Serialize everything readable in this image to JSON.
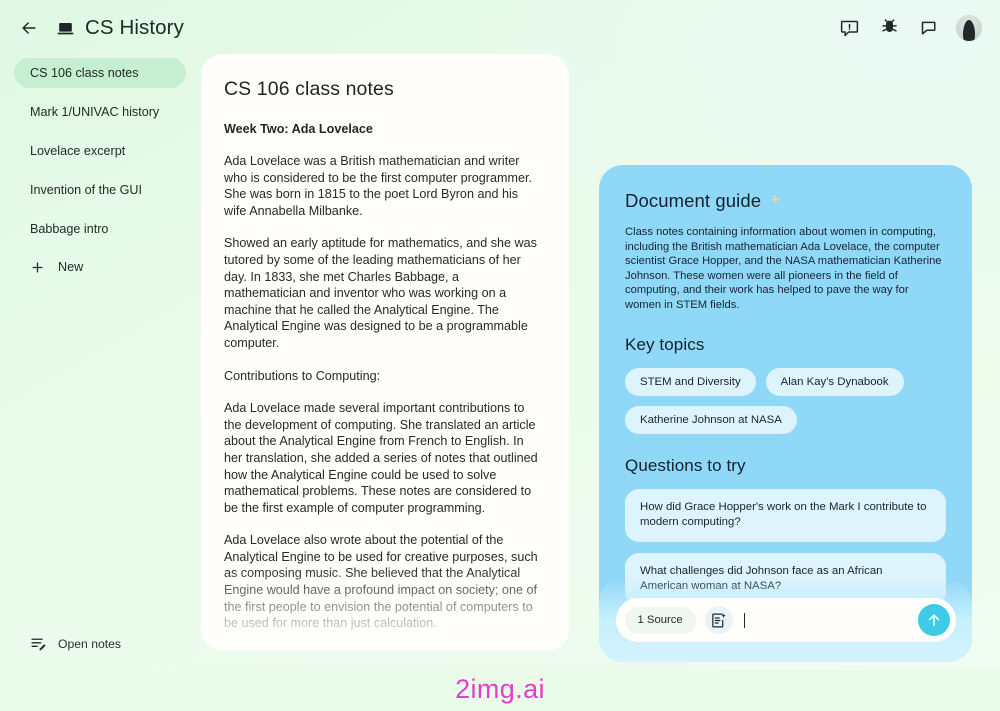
{
  "header": {
    "back_icon": "arrow-left-icon",
    "doc_icon": "laptop-icon",
    "title": "CS History",
    "actions": [
      {
        "name": "feedback-icon",
        "label": "Feedback"
      },
      {
        "name": "bug-report-icon",
        "label": "Report a bug"
      },
      {
        "name": "chat-icon",
        "label": "Chat"
      },
      {
        "name": "avatar",
        "label": "Account"
      }
    ]
  },
  "sidebar": {
    "items": [
      {
        "label": "CS 106 class notes",
        "active": true
      },
      {
        "label": "Mark 1/UNIVAC history",
        "active": false
      },
      {
        "label": "Lovelace excerpt",
        "active": false
      },
      {
        "label": "Invention of the GUI",
        "active": false
      },
      {
        "label": "Babbage intro",
        "active": false
      }
    ],
    "new_label": "New",
    "new_icon": "plus-icon",
    "open_notes_label": "Open notes",
    "open_notes_icon": "edit-note-icon"
  },
  "document": {
    "title": "CS 106 class notes",
    "subtitle": "Week Two: Ada Lovelace",
    "paragraphs": [
      "Ada Lovelace was a British mathematician and writer who is considered to be the first computer programmer. She was born in 1815 to the poet Lord Byron and his wife Annabella Milbanke.",
      "Showed an early aptitude for mathematics, and she was tutored by some of the leading mathematicians of her day. In 1833, she met Charles Babbage, a mathematician and inventor who was working on a machine that he called the Analytical Engine. The Analytical Engine was designed to be a programmable computer.",
      "Contributions to Computing:",
      "Ada Lovelace made several important contributions to the development of computing. She translated an article about the Analytical Engine from French to English. In her translation, she added a series of notes that outlined how the Analytical Engine could be used to solve mathematical problems. These notes are considered to be the first example of computer programming.",
      "Ada Lovelace also wrote about the potential of the Analytical Engine to be used for creative purposes, such as composing music. She believed that the Analytical Engine would have a profound impact on society; one of the first people to envision the potential of computers to be used for more than just calculation."
    ]
  },
  "guide": {
    "heading": "Document guide",
    "heading_icon": "sparkle-icon",
    "summary": "Class notes containing information about women in computing, including the British mathematician Ada Lovelace, the computer scientist Grace Hopper, and the NASA mathematician Katherine Johnson. These women were all pioneers in the field of computing, and their work has helped to pave the way for women in STEM fields.",
    "key_topics_heading": "Key topics",
    "key_topics": [
      "STEM and Diversity",
      "Alan Kay's Dynabook",
      "Katherine Johnson at NASA"
    ],
    "questions_heading": "Questions to try",
    "questions": [
      "How did Grace Hopper's work on the Mark I contribute to modern computing?",
      "What challenges did Johnson face as an African American woman at NASA?"
    ]
  },
  "composer": {
    "source_chip_label": "1 Source",
    "add_note_icon": "add-note-icon",
    "input_value": "",
    "input_placeholder": "",
    "send_icon": "arrow-up-icon"
  },
  "watermark": "2img.ai",
  "colors": {
    "page_background": "#eafbea",
    "sidebar_active_pill": "#c6efd1",
    "document_card": "#fffefa",
    "guide_panel": "#8fd8f8",
    "guide_chip": "#ddf4fd",
    "composer_tray": "#c9f0fd",
    "send_button": "#3fcbe8",
    "sparkle": "#f4e073",
    "watermark": "#e23fd0"
  }
}
